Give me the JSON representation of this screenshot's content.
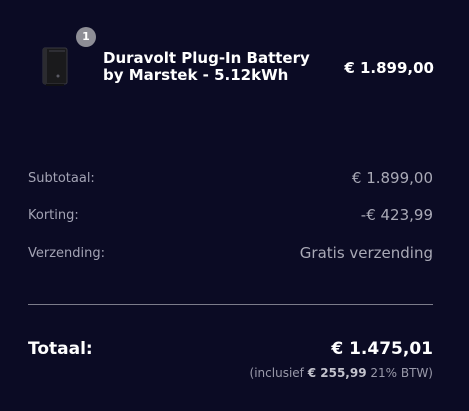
{
  "cart_item": {
    "quantity_badge": "1",
    "name": "Duravolt Plug-In Battery by Marstek - 5.12kWh",
    "price": "€ 1.899,00",
    "thumbnail_icon": "battery-product-image"
  },
  "summary": {
    "subtotal_label": "Subtotaal:",
    "subtotal_value": "€ 1.899,00",
    "discount_label": "Korting:",
    "discount_value": "-€ 423,99",
    "shipping_label": "Verzending:",
    "shipping_value": "Gratis verzending"
  },
  "total": {
    "label": "Totaal:",
    "value": "€ 1.475,01",
    "vat_prefix": "(inclusief",
    "vat_amount": "€ 255,99",
    "vat_suffix": "21% BTW)"
  },
  "colors": {
    "background": "#0b0b24",
    "badge": "#8e8e96",
    "muted_text": "#a3a3b4",
    "divider": "#7c7c8a"
  }
}
